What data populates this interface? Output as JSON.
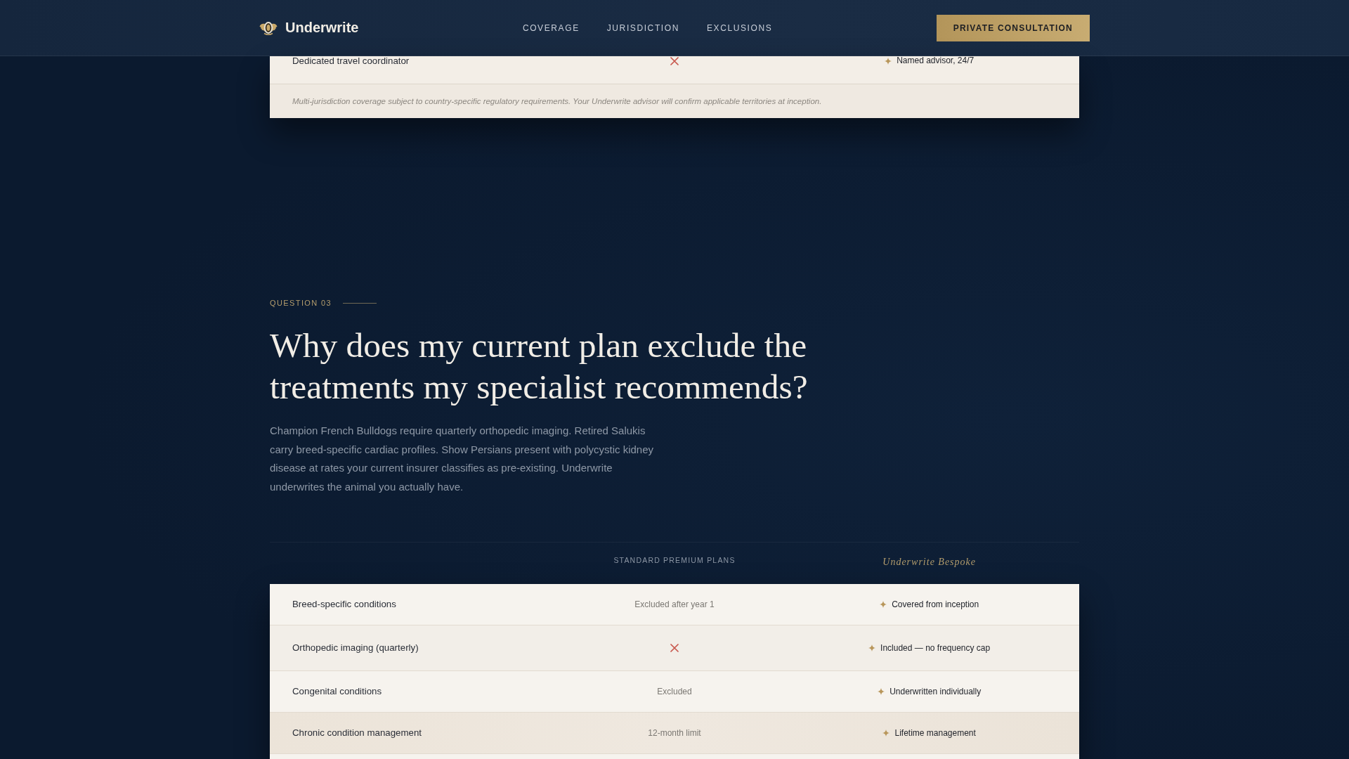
{
  "header": {
    "brand": "Underwrite",
    "nav": [
      {
        "label": "COVERAGE"
      },
      {
        "label": "JURISDICTION"
      },
      {
        "label": "EXCLUSIONS"
      }
    ],
    "cta": "PRIVATE CONSULTATION"
  },
  "previous_table": {
    "rows": [
      {
        "feature": "Dedicated travel coordinator",
        "standard": {
          "kind": "cross"
        },
        "bespoke": "Named advisor, 24/7",
        "highlighted": false
      }
    ],
    "footnote": "Multi-jurisdiction coverage subject to country-specific regulatory requirements. Your Underwrite advisor will confirm applicable territories at inception."
  },
  "question": {
    "eyebrow": "QUESTION 03",
    "title": "Why does my current plan exclude the treatments my specialist recommends?",
    "body": "Champion French Bulldogs require quarterly orthopedic imaging. Retired Salukis carry breed-specific cardiac profiles. Show Persians present with polycystic kidney disease at rates your current insurer classifies as pre-existing. Underwrite underwrites the animal you actually have."
  },
  "comparison_table": {
    "columns": [
      {
        "kind": "standard",
        "label": "STANDARD PREMIUM PLANS"
      },
      {
        "kind": "bespoke",
        "label": "Underwrite Bespoke"
      }
    ],
    "rows": [
      {
        "feature": "Breed-specific conditions",
        "standard": {
          "kind": "text",
          "text": "Excluded after year 1"
        },
        "bespoke": "Covered from inception",
        "highlighted": false
      },
      {
        "feature": "Orthopedic imaging (quarterly)",
        "standard": {
          "kind": "cross"
        },
        "bespoke": "Included — no frequency cap",
        "highlighted": false
      },
      {
        "feature": "Congenital conditions",
        "standard": {
          "kind": "text",
          "text": "Excluded"
        },
        "bespoke": "Underwritten individually",
        "highlighted": false
      },
      {
        "feature": "Chronic condition management",
        "standard": {
          "kind": "text",
          "text": "12-month limit"
        },
        "bespoke": "Lifetime management",
        "highlighted": true
      }
    ]
  }
}
